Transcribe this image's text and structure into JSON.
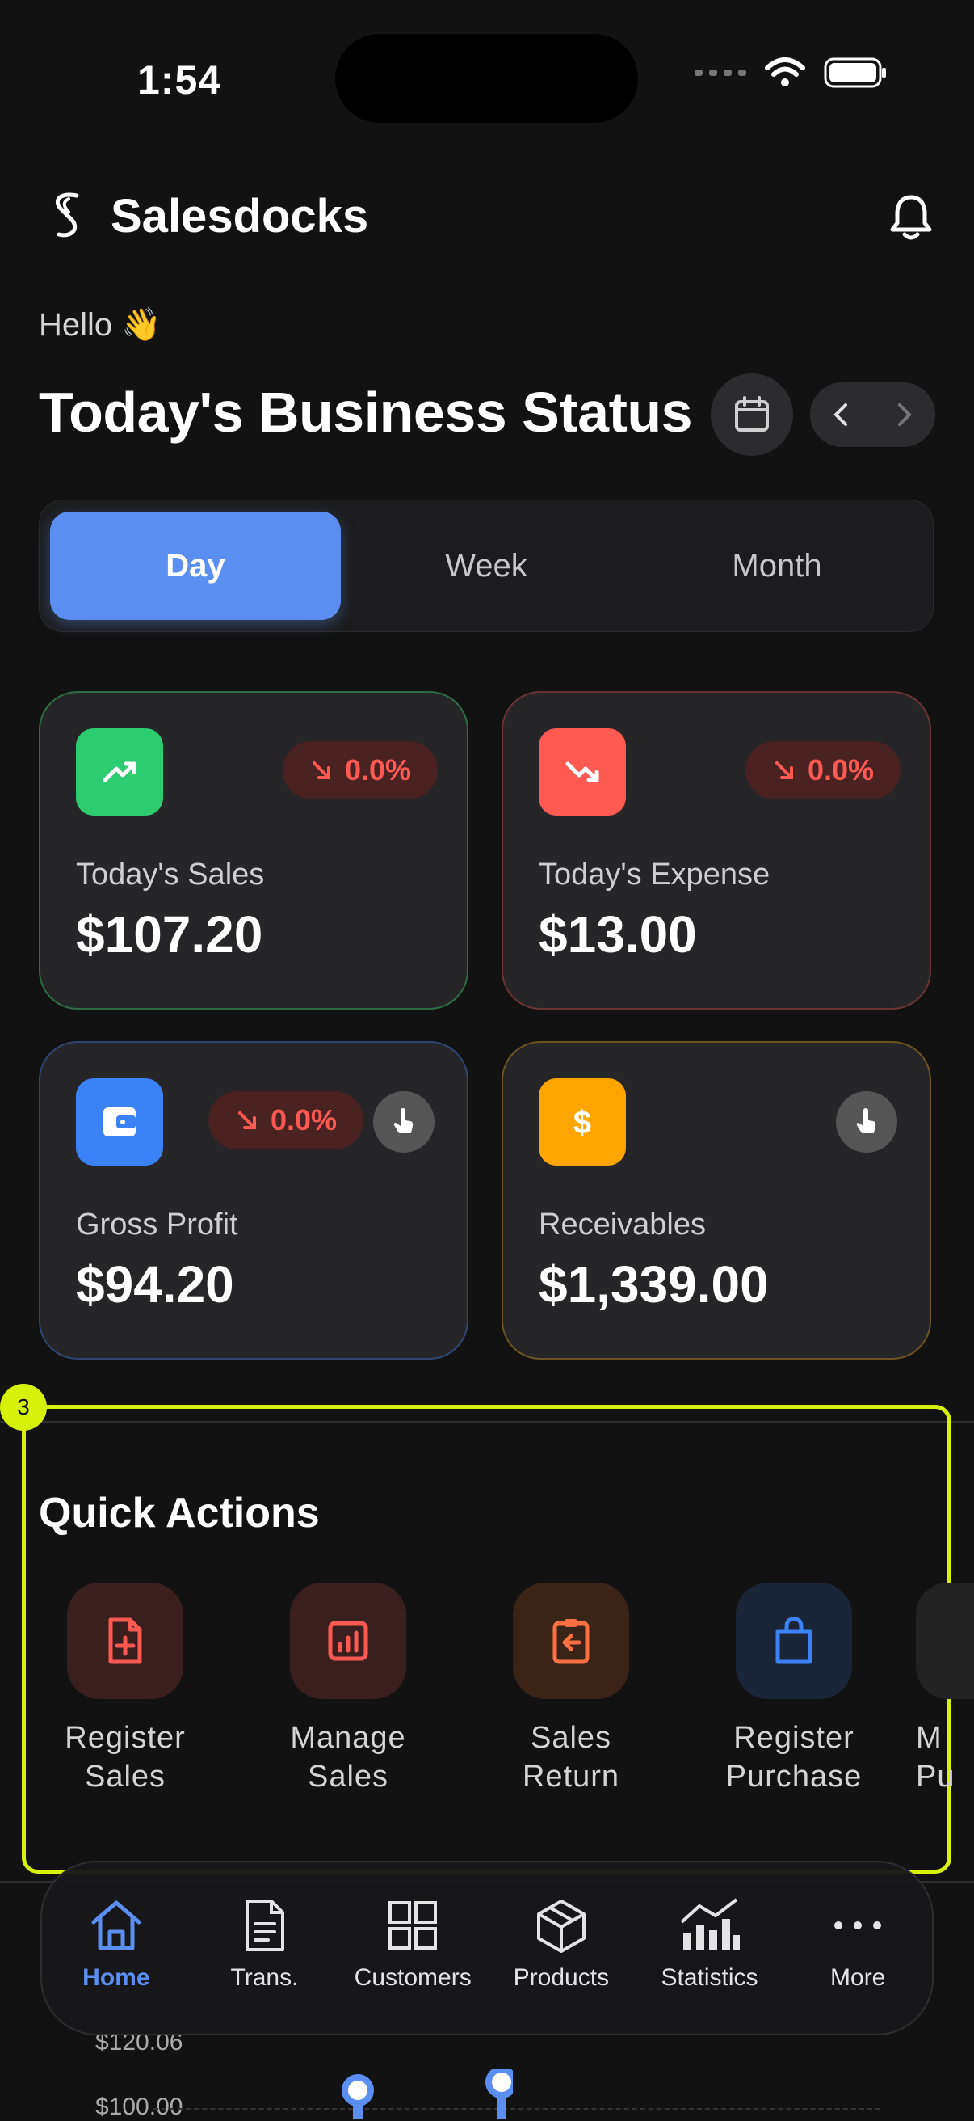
{
  "status_bar": {
    "time": "1:54"
  },
  "header": {
    "app_name": "Salesdocks"
  },
  "greeting": "Hello 👋",
  "page_title": "Today's Business Status",
  "period_tabs": [
    {
      "label": "Day",
      "active": true
    },
    {
      "label": "Week",
      "active": false
    },
    {
      "label": "Month",
      "active": false
    }
  ],
  "cards": {
    "sales": {
      "label": "Today's Sales",
      "value": "$107.20",
      "change": "0.0%",
      "icon": "trending-up-icon",
      "accent": "#2ecc71"
    },
    "expense": {
      "label": "Today's Expense",
      "value": "$13.00",
      "change": "0.0%",
      "icon": "trending-down-icon",
      "accent": "#ff5a52"
    },
    "profit": {
      "label": "Gross Profit",
      "value": "$94.20",
      "change": "0.0%",
      "icon": "wallet-icon",
      "accent": "#3b82f6"
    },
    "receivables": {
      "label": "Receivables",
      "value": "$1,339.00",
      "icon": "dollar-icon",
      "accent": "#ffa500"
    }
  },
  "quick_actions": {
    "number_badge": "3",
    "title": "Quick Actions",
    "items": [
      {
        "line1": "Register",
        "line2": "Sales",
        "icon": "file-plus-icon"
      },
      {
        "line1": "Manage",
        "line2": "Sales",
        "icon": "report-icon"
      },
      {
        "line1": "Sales",
        "line2": "Return",
        "icon": "clipboard-return-icon"
      },
      {
        "line1": "Register",
        "line2": "Purchase",
        "icon": "shopping-bag-icon"
      },
      {
        "line1": "M",
        "line2": "Pu",
        "icon": "partial-icon"
      }
    ]
  },
  "chart_peek": {
    "labels": [
      "$120.06",
      "$100.00"
    ]
  },
  "bottom_nav": [
    {
      "label": "Home",
      "icon": "home-icon",
      "active": true
    },
    {
      "label": "Trans.",
      "icon": "document-icon",
      "active": false
    },
    {
      "label": "Customers",
      "icon": "grid-icon",
      "active": false
    },
    {
      "label": "Products",
      "icon": "cube-icon",
      "active": false
    },
    {
      "label": "Statistics",
      "icon": "chart-icon",
      "active": false
    },
    {
      "label": "More",
      "icon": "more-icon",
      "active": false
    }
  ],
  "colors": {
    "primary": "#5a8ef0",
    "highlight": "#d6f20a",
    "negative": "#ff5a52"
  }
}
